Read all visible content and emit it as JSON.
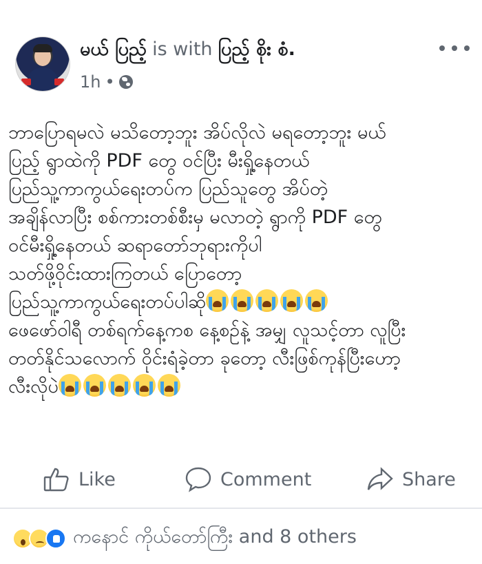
{
  "post": {
    "author": "မယ် ပြည့်",
    "with_word": "is with",
    "tagged_person": "ပြည့် စိုး စံ.",
    "time": "1h",
    "dot": "•",
    "body_lines": [
      "ဘာပြောရမလဲ မသိတော့ဘူး အိပ်လိုလဲ မရတော့ဘူး မယ်",
      "ပြည့် ရွာထဲကို PDF တွေ ဝင်ပြီး မီးရှို့နေတယ်",
      "ပြည်သူ့ကာကွယ်ရေးတပ်က ပြည်သူတွေ အိပ်တဲ့",
      "အချိန်လာပြီး စစ်ကားတစ်စီးမှ မလာတဲ့ ရွာကို PDF တွေ",
      "ဝင်မီးရှို့နေတယ် ဆရာတော်ဘုရားကိုပါ",
      "သတ်ဖို့ဝိုင်းထားကြတယ် ပြောတော့",
      "ပြည်သူ့ကာကွယ်ရေးတပ်ပါဆို",
      "ဖေဖော်ဝါရီ တစ်ရက်နေ့ကစ နေ့စဉ်နဲ့ အမျှ လူသင့်တာ လူပြီး",
      "တတ်နိုင်သလောက် ဝိုင်းရံခဲ့တာ ခုတော့ လီးဖြစ်ကုန်ပြီးဟော့",
      "လီးလိုပဲ"
    ],
    "crying_emoji_name": "loudly-crying-face"
  },
  "actions": {
    "like_label": "Like",
    "comment_label": "Comment",
    "share_label": "Share"
  },
  "reactions": {
    "icons": [
      "wow",
      "sad",
      "like"
    ],
    "summary": "ကနောင် ကိုယ်တော်ကြီး and 8 others"
  },
  "colors": {
    "secondary_text": "#606770",
    "primary_text": "#1c1e21",
    "like_blue": "#1877f2",
    "divider": "#e4e6eb"
  }
}
